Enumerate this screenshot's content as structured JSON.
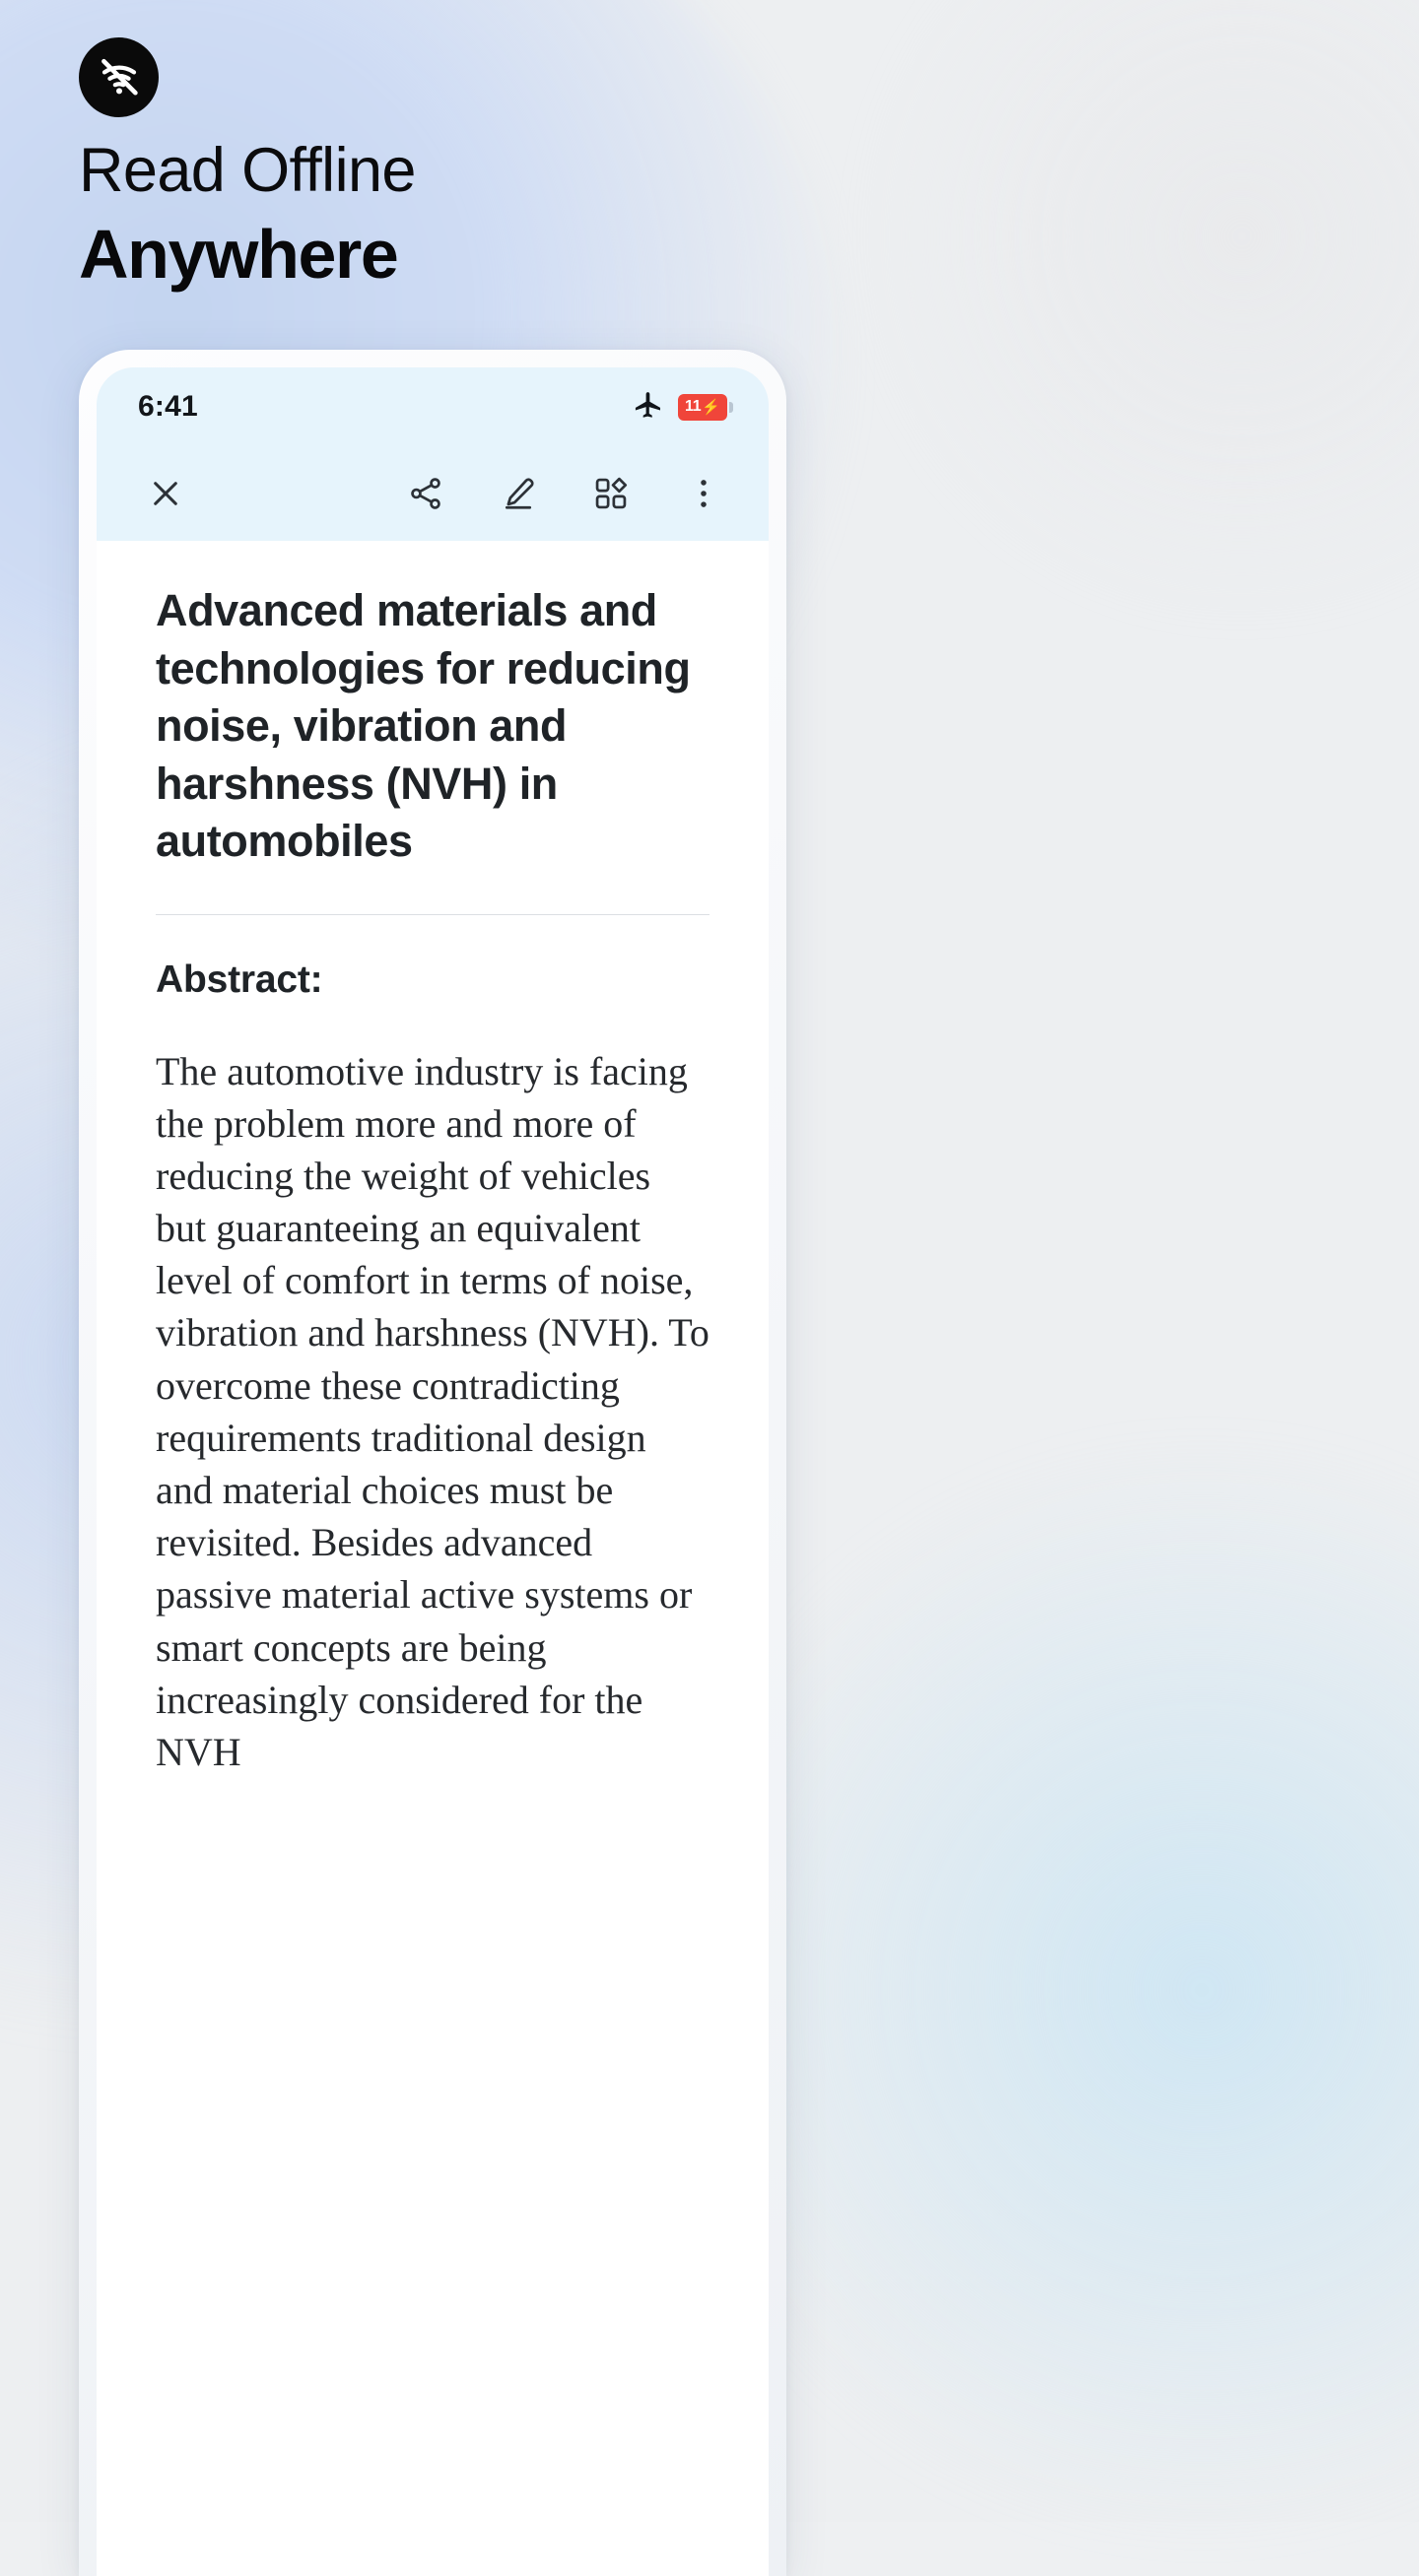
{
  "hero": {
    "badge_icon": "wifi-off-icon",
    "headline_line1": "Read Offline",
    "headline_line2": "Anywhere"
  },
  "phone": {
    "status_bar": {
      "time": "6:41",
      "airplane_icon": "airplane-mode-icon",
      "battery_percent": "11",
      "battery_charging_icon": "bolt-icon",
      "battery_color": "#f0453a"
    },
    "toolbar": {
      "close_label": "close-icon",
      "items": [
        {
          "name": "share-icon",
          "label": "Share"
        },
        {
          "name": "highlight-pen-icon",
          "label": "Highlight"
        },
        {
          "name": "grid-view-icon",
          "label": "Grid view"
        },
        {
          "name": "overflow-menu-icon",
          "label": "More options"
        }
      ]
    },
    "article": {
      "title": "Advanced materials and technologies for reducing noise, vibration and harshness (NVH) in automobiles",
      "abstract_heading": "Abstract:",
      "abstract_body": "The automotive industry is facing the problem more and more of reducing the weight of vehicles but guaranteeing an equivalent level of comfort in terms of noise, vibration and harshness (NVH). To overcome these contradicting requirements traditional design and material choices must be revisited. Besides advanced passive material active systems or smart concepts are being increasingly considered for the NVH"
    }
  },
  "theme": {
    "accent_bg": "#e6f4fc",
    "badge_bg": "#0a0a0a",
    "text_dark": "#1f2327"
  }
}
